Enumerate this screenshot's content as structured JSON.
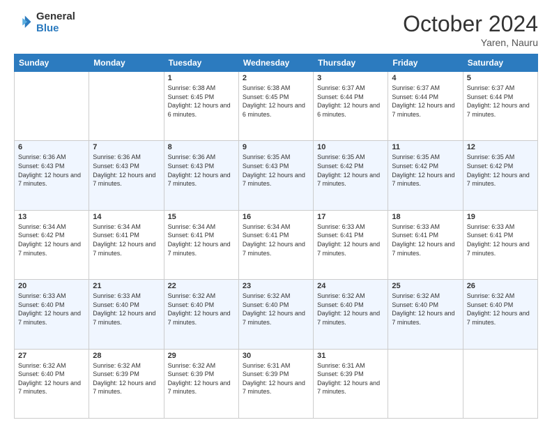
{
  "logo": {
    "general": "General",
    "blue": "Blue"
  },
  "header": {
    "month": "October 2024",
    "location": "Yaren, Nauru"
  },
  "weekdays": [
    "Sunday",
    "Monday",
    "Tuesday",
    "Wednesday",
    "Thursday",
    "Friday",
    "Saturday"
  ],
  "weeks": [
    [
      {
        "day": "",
        "info": ""
      },
      {
        "day": "",
        "info": ""
      },
      {
        "day": "1",
        "info": "Sunrise: 6:38 AM\nSunset: 6:45 PM\nDaylight: 12 hours and 6 minutes."
      },
      {
        "day": "2",
        "info": "Sunrise: 6:38 AM\nSunset: 6:45 PM\nDaylight: 12 hours and 6 minutes."
      },
      {
        "day": "3",
        "info": "Sunrise: 6:37 AM\nSunset: 6:44 PM\nDaylight: 12 hours and 6 minutes."
      },
      {
        "day": "4",
        "info": "Sunrise: 6:37 AM\nSunset: 6:44 PM\nDaylight: 12 hours and 7 minutes."
      },
      {
        "day": "5",
        "info": "Sunrise: 6:37 AM\nSunset: 6:44 PM\nDaylight: 12 hours and 7 minutes."
      }
    ],
    [
      {
        "day": "6",
        "info": "Sunrise: 6:36 AM\nSunset: 6:43 PM\nDaylight: 12 hours and 7 minutes."
      },
      {
        "day": "7",
        "info": "Sunrise: 6:36 AM\nSunset: 6:43 PM\nDaylight: 12 hours and 7 minutes."
      },
      {
        "day": "8",
        "info": "Sunrise: 6:36 AM\nSunset: 6:43 PM\nDaylight: 12 hours and 7 minutes."
      },
      {
        "day": "9",
        "info": "Sunrise: 6:35 AM\nSunset: 6:43 PM\nDaylight: 12 hours and 7 minutes."
      },
      {
        "day": "10",
        "info": "Sunrise: 6:35 AM\nSunset: 6:42 PM\nDaylight: 12 hours and 7 minutes."
      },
      {
        "day": "11",
        "info": "Sunrise: 6:35 AM\nSunset: 6:42 PM\nDaylight: 12 hours and 7 minutes."
      },
      {
        "day": "12",
        "info": "Sunrise: 6:35 AM\nSunset: 6:42 PM\nDaylight: 12 hours and 7 minutes."
      }
    ],
    [
      {
        "day": "13",
        "info": "Sunrise: 6:34 AM\nSunset: 6:42 PM\nDaylight: 12 hours and 7 minutes."
      },
      {
        "day": "14",
        "info": "Sunrise: 6:34 AM\nSunset: 6:41 PM\nDaylight: 12 hours and 7 minutes."
      },
      {
        "day": "15",
        "info": "Sunrise: 6:34 AM\nSunset: 6:41 PM\nDaylight: 12 hours and 7 minutes."
      },
      {
        "day": "16",
        "info": "Sunrise: 6:34 AM\nSunset: 6:41 PM\nDaylight: 12 hours and 7 minutes."
      },
      {
        "day": "17",
        "info": "Sunrise: 6:33 AM\nSunset: 6:41 PM\nDaylight: 12 hours and 7 minutes."
      },
      {
        "day": "18",
        "info": "Sunrise: 6:33 AM\nSunset: 6:41 PM\nDaylight: 12 hours and 7 minutes."
      },
      {
        "day": "19",
        "info": "Sunrise: 6:33 AM\nSunset: 6:41 PM\nDaylight: 12 hours and 7 minutes."
      }
    ],
    [
      {
        "day": "20",
        "info": "Sunrise: 6:33 AM\nSunset: 6:40 PM\nDaylight: 12 hours and 7 minutes."
      },
      {
        "day": "21",
        "info": "Sunrise: 6:33 AM\nSunset: 6:40 PM\nDaylight: 12 hours and 7 minutes."
      },
      {
        "day": "22",
        "info": "Sunrise: 6:32 AM\nSunset: 6:40 PM\nDaylight: 12 hours and 7 minutes."
      },
      {
        "day": "23",
        "info": "Sunrise: 6:32 AM\nSunset: 6:40 PM\nDaylight: 12 hours and 7 minutes."
      },
      {
        "day": "24",
        "info": "Sunrise: 6:32 AM\nSunset: 6:40 PM\nDaylight: 12 hours and 7 minutes."
      },
      {
        "day": "25",
        "info": "Sunrise: 6:32 AM\nSunset: 6:40 PM\nDaylight: 12 hours and 7 minutes."
      },
      {
        "day": "26",
        "info": "Sunrise: 6:32 AM\nSunset: 6:40 PM\nDaylight: 12 hours and 7 minutes."
      }
    ],
    [
      {
        "day": "27",
        "info": "Sunrise: 6:32 AM\nSunset: 6:40 PM\nDaylight: 12 hours and 7 minutes."
      },
      {
        "day": "28",
        "info": "Sunrise: 6:32 AM\nSunset: 6:39 PM\nDaylight: 12 hours and 7 minutes."
      },
      {
        "day": "29",
        "info": "Sunrise: 6:32 AM\nSunset: 6:39 PM\nDaylight: 12 hours and 7 minutes."
      },
      {
        "day": "30",
        "info": "Sunrise: 6:31 AM\nSunset: 6:39 PM\nDaylight: 12 hours and 7 minutes."
      },
      {
        "day": "31",
        "info": "Sunrise: 6:31 AM\nSunset: 6:39 PM\nDaylight: 12 hours and 7 minutes."
      },
      {
        "day": "",
        "info": ""
      },
      {
        "day": "",
        "info": ""
      }
    ]
  ]
}
